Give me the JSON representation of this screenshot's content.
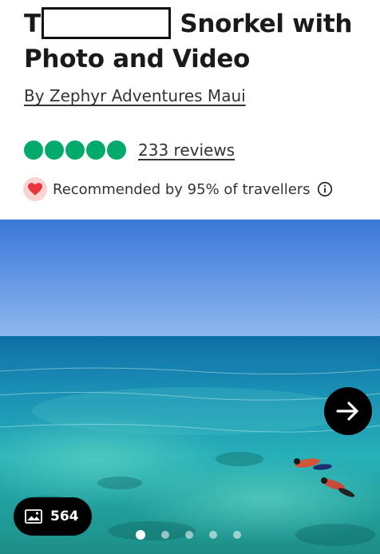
{
  "listing": {
    "title_prefix": "T",
    "title_suffix": "Snorkel with Photo and Video",
    "operator_label": "By Zephyr Adventures Maui",
    "rating_bubbles": 5,
    "reviews_label": "233 reviews",
    "recommendation": "Recommended by 95% of travellers"
  },
  "gallery": {
    "photo_count": "564",
    "active_slide": 1,
    "slide_count": 5
  },
  "colors": {
    "rating_green": "#00aa6c",
    "heart_red": "#e8343b",
    "heart_bg": "#fbd3d3"
  },
  "icons": [
    "heart-icon",
    "info-icon",
    "arrow-right-icon",
    "image-icon"
  ]
}
